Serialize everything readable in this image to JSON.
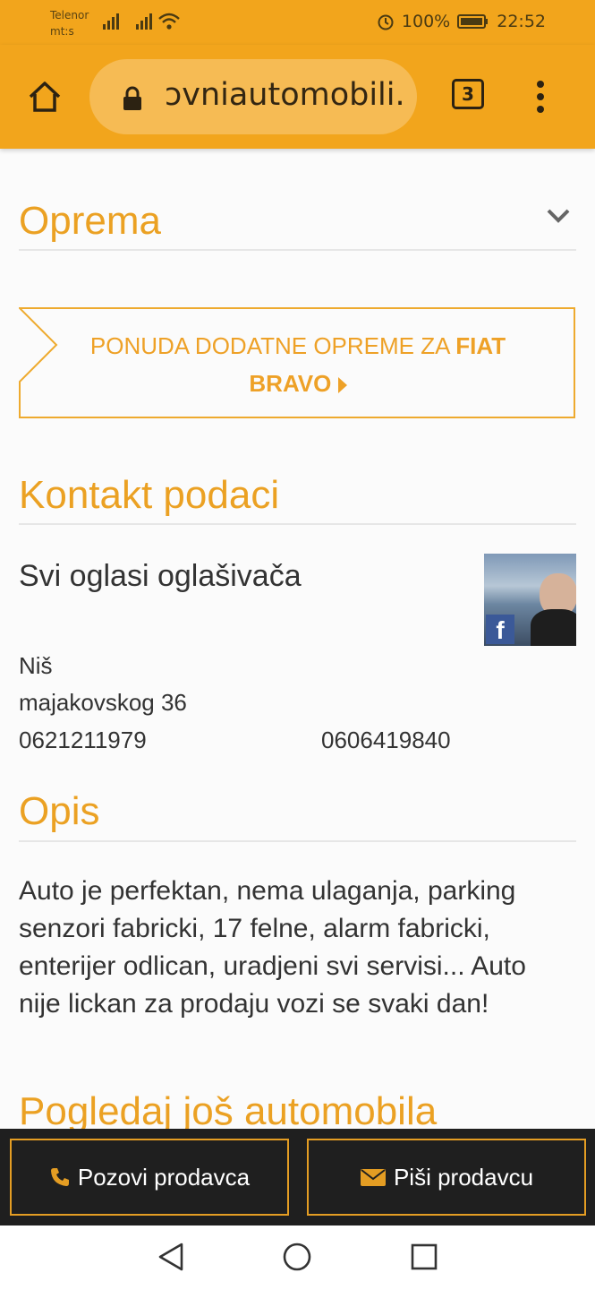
{
  "status_bar": {
    "carrier_1": "Telenor",
    "carrier_2": "mt:s",
    "battery": "100%",
    "time": "22:52"
  },
  "browser": {
    "url_fragment": "ɔvniautomobili.c",
    "tab_count": "3",
    "icons": [
      "home-icon",
      "lock-icon",
      "tabs-icon",
      "overflow-menu-icon"
    ]
  },
  "sections": {
    "oprema_title": "Oprema",
    "promo_text": "PONUDA DODATNE OPREME ZA",
    "promo_bold_1": "FIAT",
    "promo_bold_2": "BRAVO",
    "kontakt_title": "Kontakt podaci",
    "all_ads_link": "Svi oglasi oglašivača",
    "city": "Niš",
    "address": "majakovskog 36",
    "phone_1": "0621211979",
    "phone_2": "0606419840",
    "opis_title": "Opis",
    "description": "Auto je perfektan, nema ulaganja, parking senzori fabricki, 17 felne, alarm fabricki, enterijer odlican, uradjeni svi servisi... Auto nije lickan za prodaju vozi se svaki dan!",
    "more_title": "Pogledaj još automobila"
  },
  "actions": {
    "call_label": "Pozovi prodavca",
    "message_label": "Piši prodavcu"
  },
  "colors": {
    "accent": "#f2a51c",
    "heading": "#eba123",
    "link": "#1a76c7",
    "action_bar": "#1f1f1f"
  }
}
